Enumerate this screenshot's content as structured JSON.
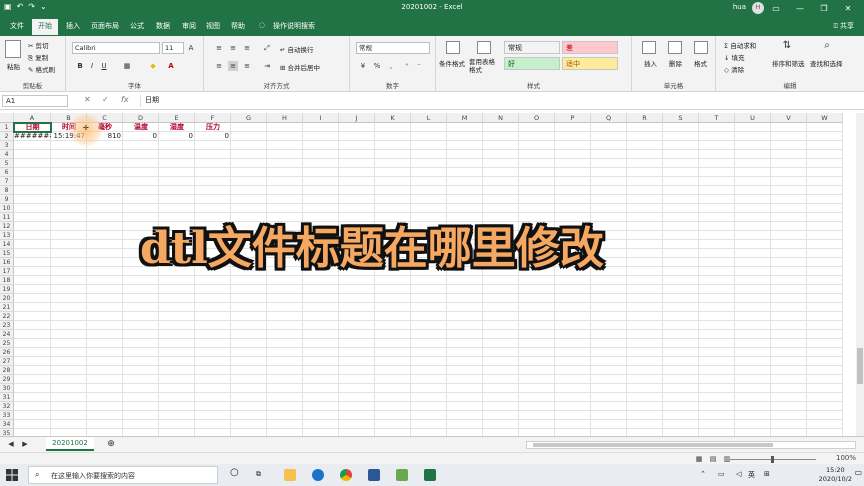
{
  "window": {
    "title": "20201002  -  Excel",
    "user_name": "hua",
    "user_initial": "H",
    "share_label": "共享"
  },
  "menu_tabs": [
    "文件",
    "开始",
    "插入",
    "页面布局",
    "公式",
    "数据",
    "审阅",
    "视图",
    "帮助",
    "操作说明搜索"
  ],
  "ribbon": {
    "clipboard": {
      "paste": "粘贴",
      "cut": "剪切",
      "copy": "复制",
      "format_painter": "格式刷",
      "label": "剪贴板"
    },
    "font": {
      "name": "Calibri",
      "size": "11",
      "bold": "B",
      "italic": "I",
      "underline": "U",
      "label": "字体"
    },
    "alignment": {
      "wrap": "自动换行",
      "merge": "合并后居中",
      "label": "对齐方式"
    },
    "number": {
      "format": "常规",
      "label": "数字"
    },
    "styles": {
      "conditional": "条件格式",
      "table": "套用表格格式",
      "cells": [
        {
          "text": "常规",
          "bg": "#ffffff",
          "fg": "#000000"
        },
        {
          "text": "差",
          "bg": "#ffc7ce",
          "fg": "#9c0006"
        },
        {
          "text": "好",
          "bg": "#c6efce",
          "fg": "#006100"
        },
        {
          "text": "适中",
          "bg": "#ffeb9c",
          "fg": "#9c5700"
        }
      ],
      "label": "样式"
    },
    "cells_group": {
      "insert": "插入",
      "delete": "删除",
      "format": "格式",
      "label": "单元格"
    },
    "editing": {
      "autosum": "自动求和",
      "fill": "填充",
      "clear": "清除",
      "sort": "排序和筛选",
      "find": "查找和选择",
      "label": "编辑"
    }
  },
  "formula_bar": {
    "name_box": "A1",
    "cancel": "✕",
    "enter": "✓",
    "fx": "fx",
    "content": "日期"
  },
  "columns": [
    "A",
    "B",
    "C",
    "D",
    "E",
    "F",
    "G",
    "H",
    "I",
    "J",
    "K",
    "L",
    "M",
    "N",
    "O",
    "P",
    "Q",
    "R",
    "S",
    "T",
    "U",
    "V",
    "W"
  ],
  "rows_count": 35,
  "row_labels": [
    "1",
    "2",
    "3",
    "4",
    "5",
    "6",
    "7",
    "8",
    "9",
    "10",
    "11",
    "12",
    "13",
    "14",
    "15",
    "16",
    "17",
    "18",
    "19",
    "20",
    "21",
    "22",
    "23",
    "24",
    "25",
    "26",
    "27",
    "28",
    "29",
    "30",
    "31",
    "32",
    "33",
    "34",
    "35"
  ],
  "sheet": {
    "header": [
      "日期",
      "时间",
      "毫秒",
      "温度",
      "湿度",
      "压力"
    ],
    "row2": [
      "########",
      "15:19:47",
      "810",
      "0",
      "0",
      "0"
    ]
  },
  "overlay_caption": "dtl文件标题在哪里修改",
  "sheet_tab": "20201002",
  "add_sheet": "⊕",
  "status": {
    "zoom": "100%"
  },
  "taskbar": {
    "search_placeholder": "在这里输入你要搜索的内容",
    "ime": "英",
    "time": "15:20",
    "date": "2020/10/2"
  },
  "colors": {
    "excel_green": "#217346",
    "header_red": "#b0002a",
    "overlay_orange": "#f5a862"
  }
}
